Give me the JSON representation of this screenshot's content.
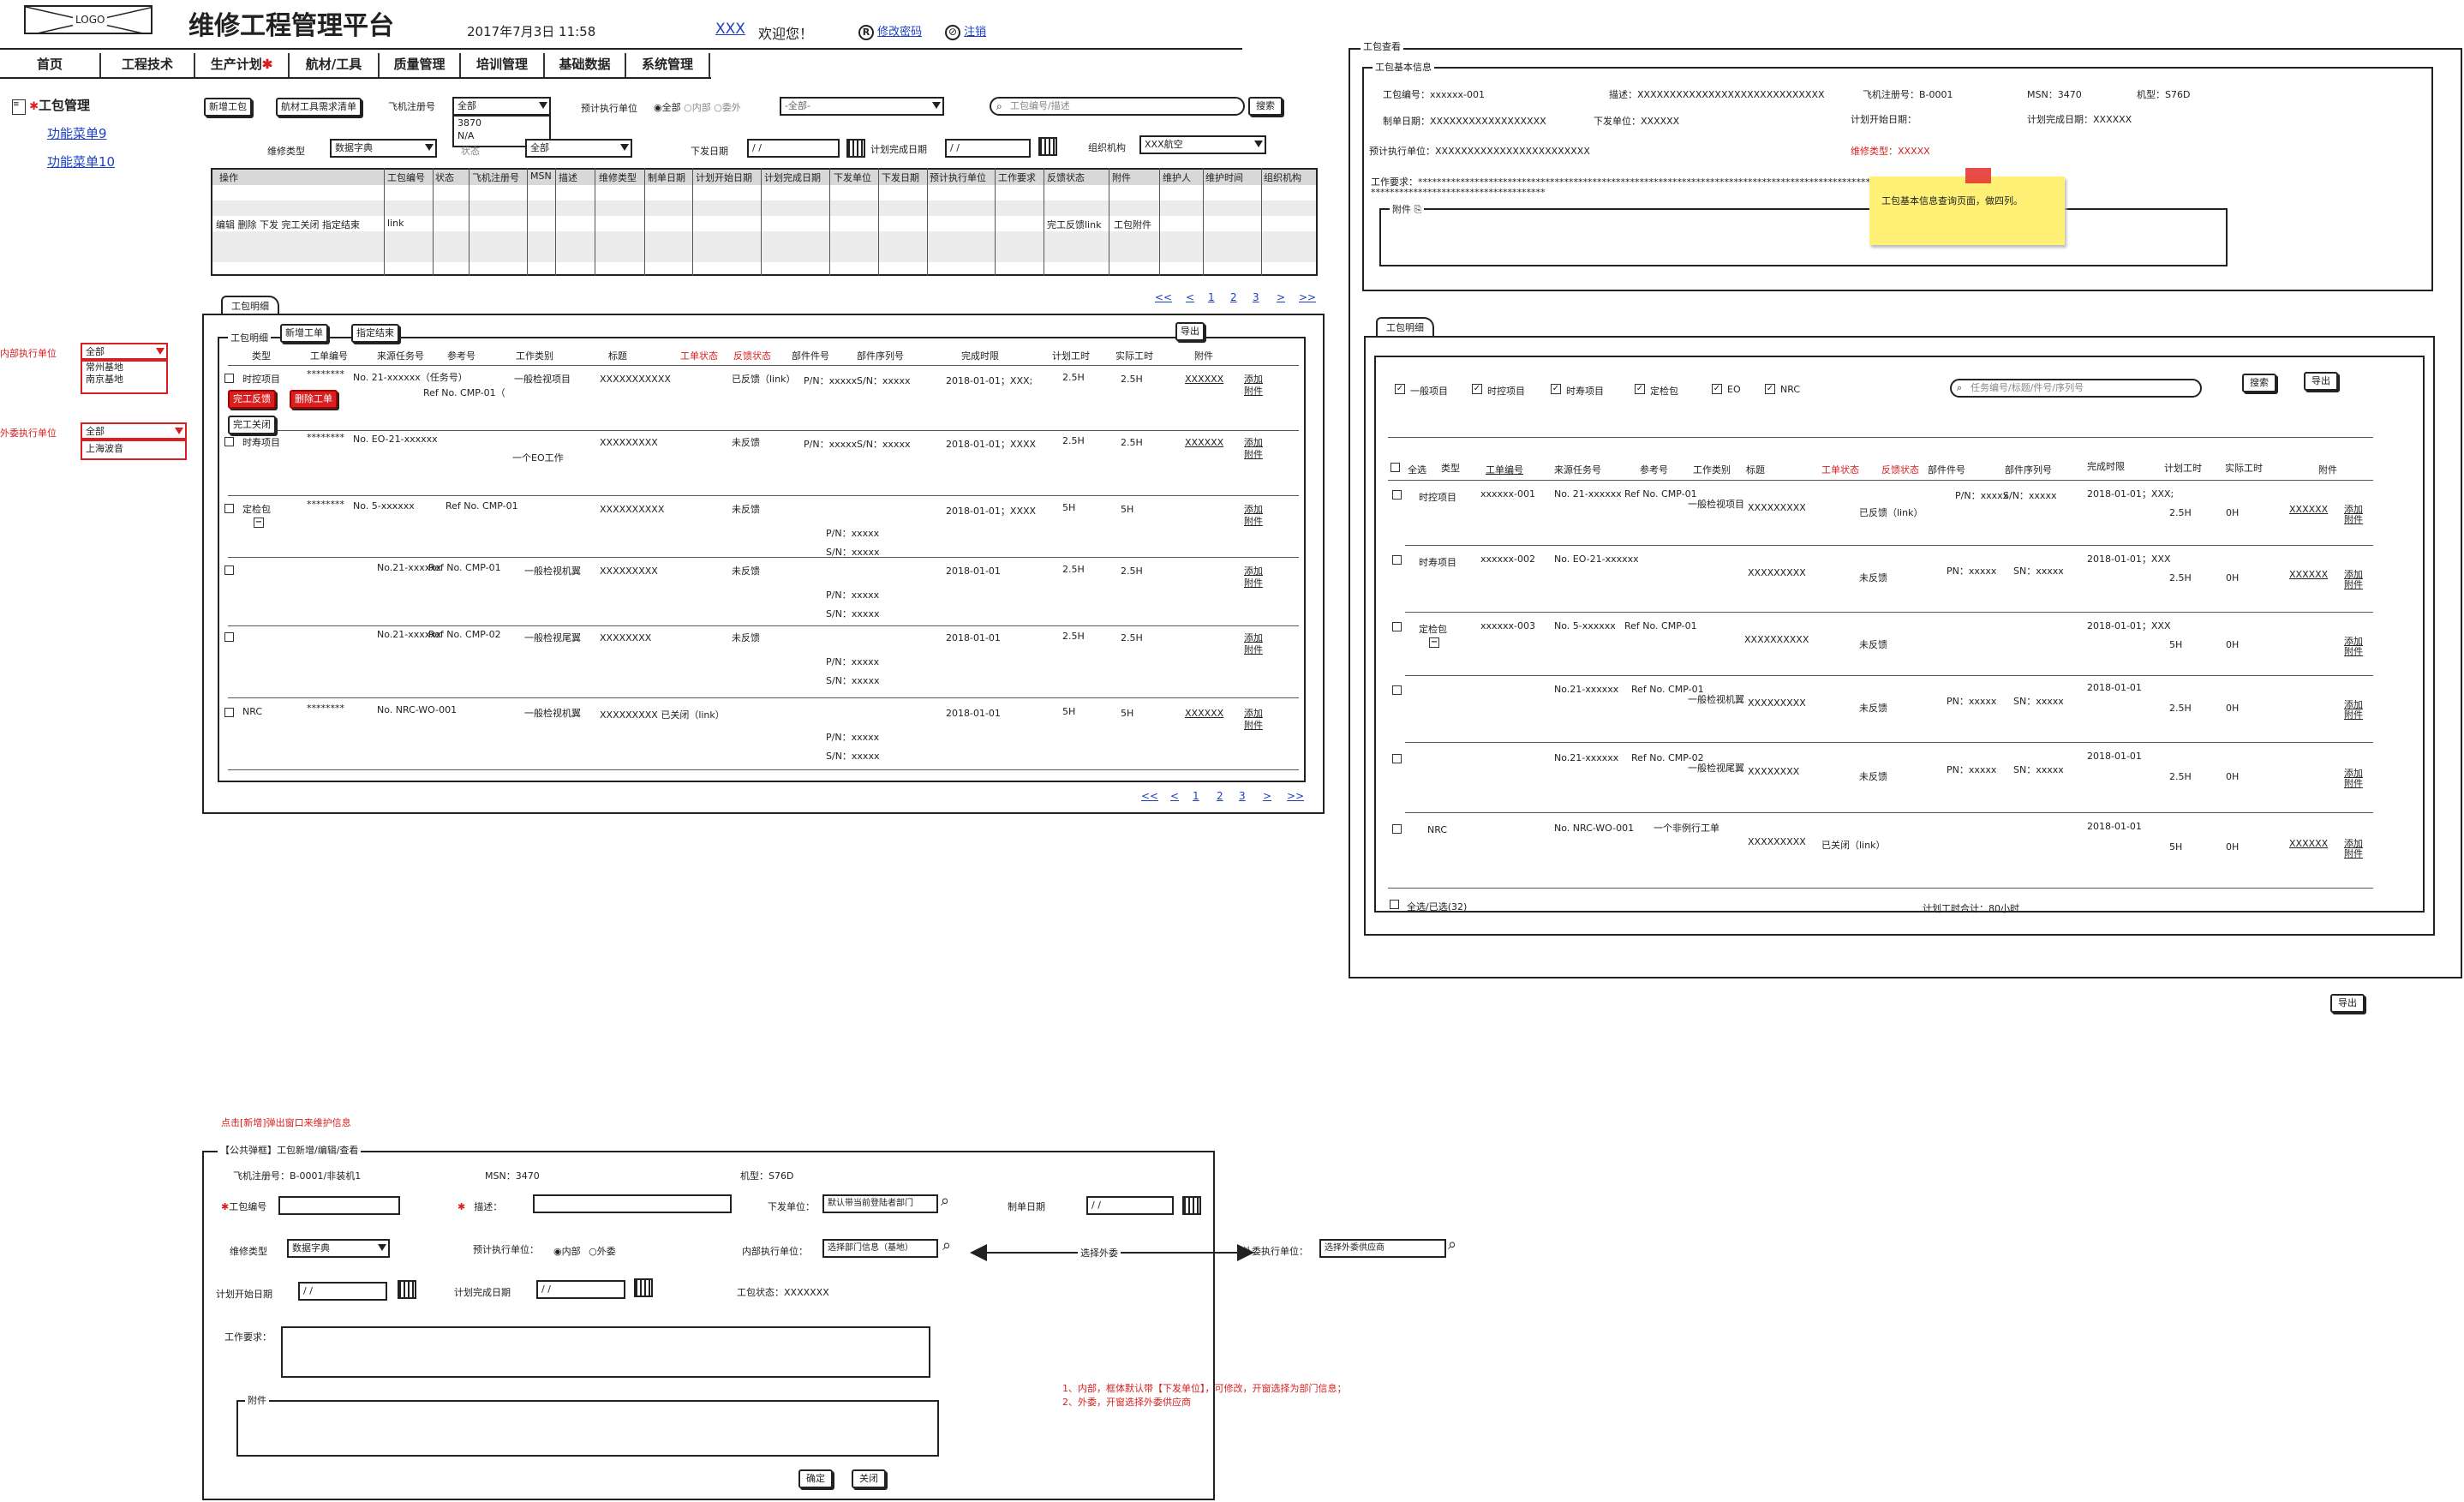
{
  "header": {
    "logo": "LOGO",
    "title": "维修工程管理平台",
    "datetime": "2017年7月3日 11:58",
    "user": "XXX",
    "welcome": "欢迎您！",
    "change_pwd": "修改密码",
    "logout": "注销"
  },
  "nav": [
    "首页",
    "工程技术",
    "生产计划",
    "航材/工具",
    "质量管理",
    "培训管理",
    "基础数据",
    "系统管理"
  ],
  "sidebar": {
    "title": "工包管理",
    "items": [
      "功能菜单9",
      "功能菜单10"
    ]
  },
  "left_notes": {
    "inner_label": "内部执行单位",
    "inner_value": "全部",
    "inner_options": [
      "常州基地",
      "南京基地"
    ],
    "outer_label": "外委执行单位",
    "outer_value": "全部",
    "outer_options": [
      "上海波音"
    ]
  },
  "toolbar": {
    "new_pkg": "新增工包",
    "tool_req": "航材工具需求清单",
    "reg_label": "飞机注册号",
    "reg_value": "全部",
    "reg_options": [
      "3870",
      "N/A"
    ],
    "status_label": "状态",
    "exec_label": "预计执行单位",
    "exec_all": "全部",
    "exec_inner": "内部",
    "exec_outer": "委外",
    "exec_select": "-全部-",
    "search_placeholder": "工包编号/描述",
    "search_btn": "搜索",
    "repair_type": "维修类型",
    "repair_type_value": "数据字典",
    "status_value": "全部",
    "issue_date": "下发日期",
    "date_ph": "/ /",
    "plan_done": "计划完成日期",
    "org_label": "组织机构",
    "org_value": "XXX航空"
  },
  "main_table": {
    "headers": [
      "操作",
      "工包编号",
      "状态",
      "飞机注册号",
      "MSN",
      "描述",
      "维修类型",
      "制单日期",
      "计划开始日期",
      "计划完成日期",
      "下发单位",
      "下发日期",
      "预计执行单位",
      "工作要求",
      "反馈状态",
      "附件",
      "维护人",
      "维护时间",
      "组织机构"
    ],
    "ops": "编辑  删除  下发  完工关闭  指定结束",
    "link": "link",
    "feedback": "完工反馈link",
    "attach": "工包附件"
  },
  "detail": {
    "tab": "工包明细",
    "inner_tab": "工包明细",
    "add_card": "新增工单",
    "assign_end": "指定结束",
    "export": "导出",
    "pages": [
      "<<",
      "<",
      "1",
      "2",
      "3",
      ">",
      ">>"
    ],
    "headers": [
      "类型",
      "工单编号",
      "来源任务号",
      "参考号",
      "工作类别",
      "标题",
      "工单状态",
      "反馈状态",
      "部件件号",
      "部件序列号",
      "完成时限",
      "计划工时",
      "实际工时",
      "附件"
    ],
    "btn_feedback": "完工反馈",
    "btn_delete": "删除工单",
    "btn_close": "完工关闭",
    "rows": [
      {
        "type": "时控项目",
        "no": "********",
        "src": "No. 21-xxxxxx（任务号）",
        "ref": "Ref No. CMP-01（",
        "cat": "一般检视项目",
        "title": "XXXXXXXXXXX",
        "status": "已反馈（link）",
        "pn": "P/N：xxxxx",
        "sn": "S/N：xxxxx",
        "due": "2018-01-01；XXX;",
        "plan": "2.5H",
        "act": "2.5H",
        "att": "XXXXXX",
        "add": "添加",
        "attw": "附件"
      },
      {
        "type": "时寿项目",
        "no": "********",
        "src": "No. EO-21-xxxxxx",
        "ref": "",
        "cat": "一个EO工作",
        "title": "XXXXXXXXX",
        "status": "未反馈",
        "pn": "P/N：xxxxx",
        "sn": "S/N：xxxxx",
        "due": "2018-01-01；XXXX",
        "plan": "2.5H",
        "act": "2.5H",
        "att": "XXXXXX",
        "add": "添加",
        "attw": "附件"
      },
      {
        "type": "定检包",
        "no": "********",
        "src": "No. 5-xxxxxx",
        "ref": "Ref No. CMP-01",
        "cat": "",
        "title": "XXXXXXXXXX",
        "status": "未反馈",
        "pn": "P/N：xxxxx",
        "sn": "S/N：xxxxx",
        "due": "2018-01-01；XXXX",
        "plan": "5H",
        "act": "5H",
        "att": "",
        "add": "添加",
        "attw": "附件"
      },
      {
        "type": "",
        "no": "",
        "src": "No.21-xxxxxx",
        "ref": "Ref No. CMP-01",
        "cat": "一般检视机翼",
        "title": "XXXXXXXXX",
        "status": "未反馈",
        "pn": "P/N：xxxxx",
        "sn": "S/N：xxxxx",
        "due": "2018-01-01",
        "plan": "2.5H",
        "act": "2.5H",
        "att": "",
        "add": "添加",
        "attw": "附件"
      },
      {
        "type": "",
        "no": "",
        "src": "No.21-xxxxxx",
        "ref": "Ref No. CMP-02",
        "cat": "一般检视尾翼",
        "title": "XXXXXXXX",
        "status": "未反馈",
        "pn": "P/N：xxxxx",
        "sn": "S/N：xxxxx",
        "due": "2018-01-01",
        "plan": "2.5H",
        "act": "2.5H",
        "att": "",
        "add": "添加",
        "attw": "附件"
      },
      {
        "type": "NRC",
        "no": "********",
        "src": "No. NRC-WO-001",
        "ref": "",
        "cat": "一般检视机翼",
        "title": "XXXXXXXXX 已关闭（link）",
        "status": "",
        "pn": "P/N：xxxxx",
        "sn": "S/N：xxxxx",
        "due": "2018-01-01",
        "plan": "5H",
        "act": "5H",
        "att": "XXXXXX",
        "add": "添加",
        "attw": "附件"
      }
    ]
  },
  "view": {
    "title": "工包查看",
    "basic": "工包基本信息",
    "pkg_no": "工包编号：xxxxxx-001",
    "desc": "描述：XXXXXXXXXXXXXXXXXXXXXXXXXXXXX",
    "reg": "飞机注册号：B-0001",
    "msn": "MSN：3470",
    "model": "机型：S76D",
    "made": "制单日期：XXXXXXXXXXXXXXXXXX",
    "issue_unit": "下发单位：XXXXXX",
    "plan_start": "计划开始日期：",
    "plan_end": "计划完成日期：XXXXXX",
    "exec": "预计执行单位：XXXXXXXXXXXXXXXXXXXXXXXX",
    "repair": "维修类型：XXXXX",
    "req": "工作要求：************************************************************************************************************************",
    "req2": "*************************************",
    "attach": "附件",
    "sticky": "工包基本信息查询页面，做四列。",
    "tab": "工包明细",
    "filters": [
      "一般项目",
      "时控项目",
      "时寿项目",
      "定检包",
      "EO",
      "NRC"
    ],
    "search_ph": "任务编号/标题/件号/序列号",
    "search": "搜索",
    "export": "导出",
    "headers": [
      "全选",
      "类型",
      "工单编号",
      "来源任务号",
      "参考号",
      "工作类别",
      "标题",
      "工单状态",
      "反馈状态",
      "部件件号",
      "部件序列号",
      "完成时限",
      "计划工时",
      "实际工时",
      "附件"
    ],
    "rows": [
      {
        "type": "时控项目",
        "no": "xxxxxx-001",
        "src": "No. 21-xxxxxx",
        "ref": "Ref No. CMP-01",
        "cat": "一般检视项目",
        "title": "XXXXXXXXX",
        "fb": "已反馈（link）",
        "pn": "P/N：xxxxx",
        "sn": "S/N：xxxxx",
        "due": "2018-01-01；XXX;",
        "plan": "2.5H",
        "act": "0H",
        "att": "XXXXXX"
      },
      {
        "type": "时寿项目",
        "no": "xxxxxx-002",
        "src": "No. EO-21-xxxxxx",
        "ref": "",
        "cat": "",
        "title": "XXXXXXXXX",
        "fb": "未反馈",
        "pn": "PN：xxxxx",
        "sn": "SN：xxxxx",
        "due": "2018-01-01；XXX",
        "plan": "2.5H",
        "act": "0H",
        "att": "XXXXXX"
      },
      {
        "type": "定检包",
        "no": "xxxxxx-003",
        "src": "No. 5-xxxxxx",
        "ref": "Ref No. CMP-01",
        "cat": "",
        "title": "XXXXXXXXXX",
        "fb": "未反馈",
        "pn": "",
        "sn": "",
        "due": "2018-01-01；XXX",
        "plan": "5H",
        "act": "0H",
        "att": ""
      },
      {
        "type": "",
        "no": "",
        "src": "No.21-xxxxxx",
        "ref": "Ref No. CMP-01",
        "cat": "一般检视机翼",
        "title": "XXXXXXXXX",
        "fb": "未反馈",
        "pn": "PN：xxxxx",
        "sn": "SN：xxxxx",
        "due": "2018-01-01",
        "plan": "2.5H",
        "act": "0H",
        "att": ""
      },
      {
        "type": "",
        "no": "",
        "src": "No.21-xxxxxx",
        "ref": "Ref No. CMP-02",
        "cat": "一般检视尾翼",
        "title": "XXXXXXXX",
        "fb": "未反馈",
        "pn": "PN：xxxxx",
        "sn": "SN：xxxxx",
        "due": "2018-01-01",
        "plan": "2.5H",
        "act": "0H",
        "att": ""
      },
      {
        "type": "NRC",
        "no": "",
        "src": "No. NRC-WO-001",
        "ref": "",
        "cat": "一个非例行工单",
        "title": "XXXXXXXXX",
        "fb": "已关闭（link）",
        "pn": "",
        "sn": "",
        "due": "2018-01-01",
        "plan": "5H",
        "act": "0H",
        "att": "XXXXXX"
      }
    ],
    "footer_select": "全选/已选(32)",
    "footer_total": "计划工时合计：80小时",
    "outer_export": "导出",
    "add": "添加",
    "attw": "附件"
  },
  "form": {
    "note": "点击[新增]弹出窗口来维护信息",
    "title": "【公共弹框】工包新增/编辑/查看",
    "reg": "飞机注册号：B-0001/非装机1",
    "msn": "MSN：3470",
    "model": "机型：S76D",
    "pkg_no": "工包编号",
    "desc": "描述：",
    "issue_unit": "下发单位：",
    "issue_unit_value": "默认带当前登陆者部门",
    "made": "制单日期",
    "date_ph": "/ /",
    "repair": "维修类型",
    "repair_value": "数据字典",
    "exec": "预计执行单位：",
    "inner": "内部",
    "outer": "外委",
    "inner_unit": "内部执行单位：",
    "inner_unit_value": "选择部门信息（基地）",
    "choose": "选择外委",
    "outer_unit": "外委执行单位：",
    "outer_unit_value": "选择外委供应商",
    "plan_start": "计划开始日期",
    "plan_end": "计划完成日期",
    "status": "工包状态：XXXXXXX",
    "req": "工作要求：",
    "attach": "附件",
    "ok": "确定",
    "close": "关闭",
    "note2a": "1、内部，框体默认带【下发单位】，可修改，开窗选择为部门信息；",
    "note2b": "2、外委，开窗选择外委供应商"
  }
}
